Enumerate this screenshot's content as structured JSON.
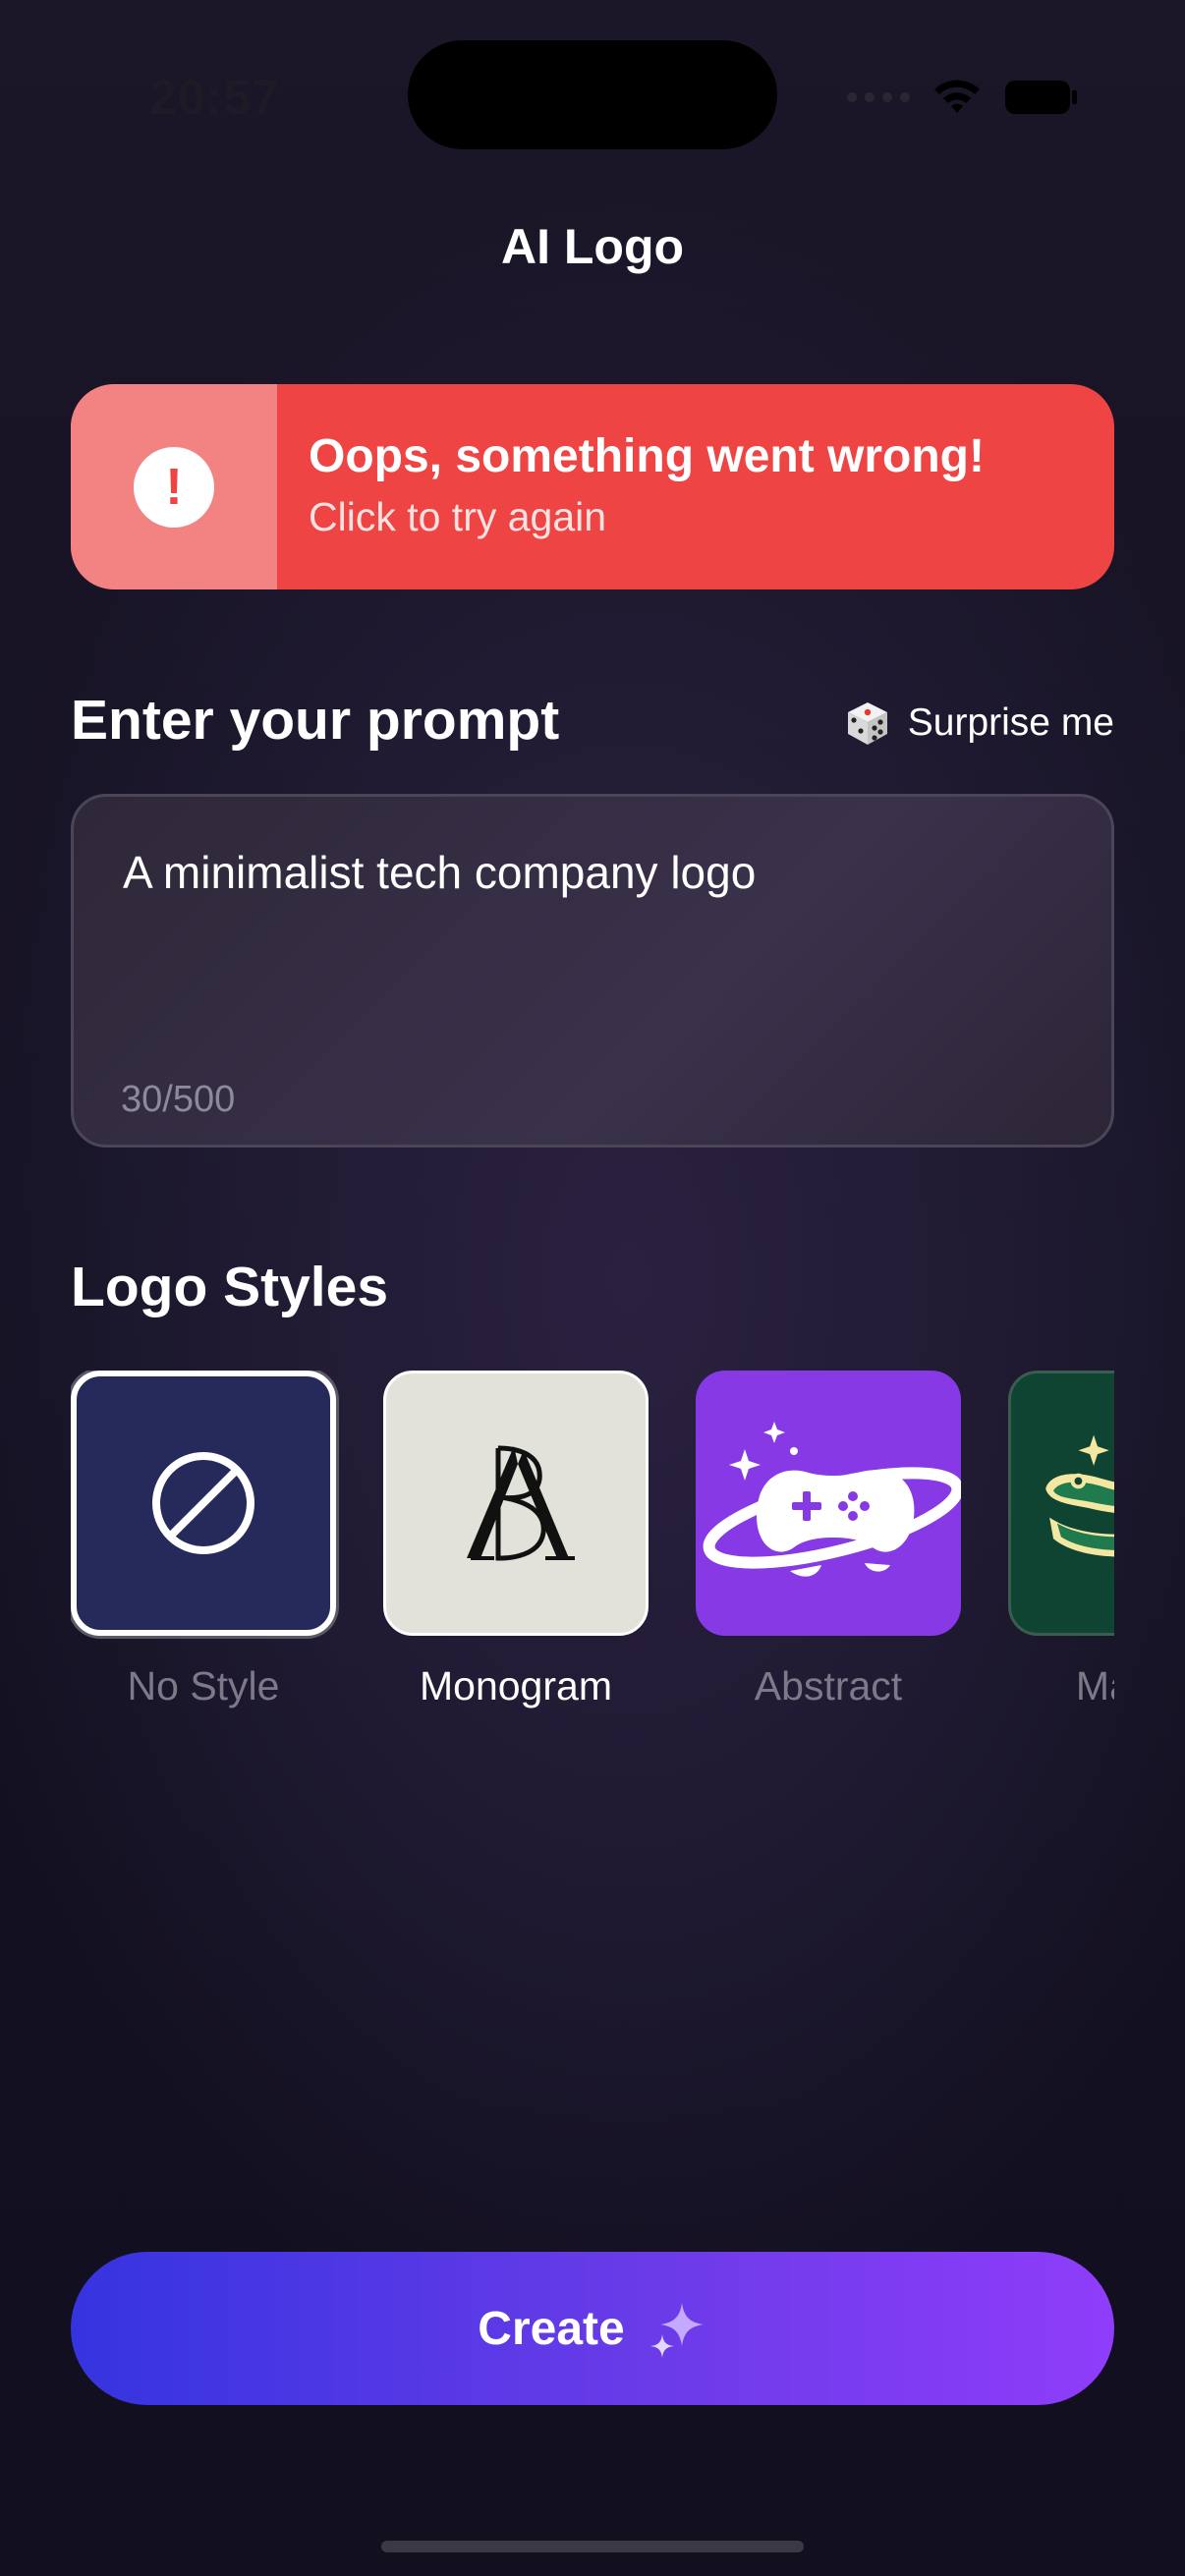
{
  "status_bar": {
    "time": "20:57"
  },
  "header": {
    "title": "AI Logo"
  },
  "error_banner": {
    "title": "Oops, something went wrong!",
    "subtitle": "Click to try again",
    "icon": "!"
  },
  "prompt": {
    "section_title": "Enter your prompt",
    "surprise_label": "Surprise me",
    "value": "A minimalist tech company logo",
    "char_count": "30/500"
  },
  "styles": {
    "section_title": "Logo Styles",
    "items": [
      {
        "label": "No Style",
        "selected": true
      },
      {
        "label": "Monogram",
        "selected": false
      },
      {
        "label": "Abstract",
        "selected": false
      },
      {
        "label": "Mascot",
        "selected": false
      }
    ]
  },
  "create": {
    "label": "Create"
  },
  "colors": {
    "error": "#ef4444",
    "error_icon_bg": "#f38383",
    "button_gradient_start": "#3534e0",
    "button_gradient_end": "#8f3dfa",
    "no_style_bg": "#252a5a",
    "monogram_bg": "#e2e1da",
    "abstract_bg": "#8639e4",
    "mascot_bg": "#0f4432"
  }
}
